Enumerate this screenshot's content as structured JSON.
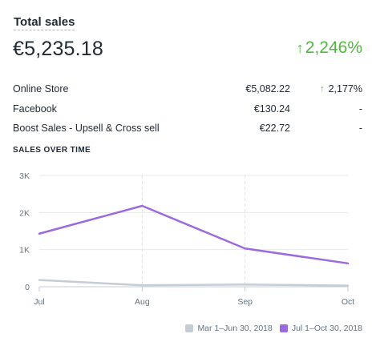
{
  "card": {
    "title": "Total sales",
    "total": "€5,235.18",
    "growth": "2,246%",
    "growth_color": "#50b83c",
    "rows": [
      {
        "name": "Online Store",
        "value": "€5,082.22",
        "change": "2,177%",
        "change_up": true
      },
      {
        "name": "Facebook",
        "value": "€130.24",
        "change": "-",
        "change_up": false
      },
      {
        "name": "Boost Sales - Upsell & Cross sell",
        "value": "€22.72",
        "change": "-",
        "change_up": false
      }
    ],
    "section_title": "SALES OVER TIME"
  },
  "chart_data": {
    "type": "line",
    "title": "",
    "xlabel": "",
    "ylabel": "",
    "categories": [
      "Jul",
      "Aug",
      "Sep",
      "Oct"
    ],
    "y_ticks": [
      0,
      1000,
      2000,
      3000
    ],
    "y_tick_labels": [
      "0",
      "1K",
      "2K",
      "3K"
    ],
    "ylim": [
      0,
      3000
    ],
    "grid": true,
    "legend_position": "bottom-right",
    "series": [
      {
        "name": "Mar 1–Jun 30, 2018",
        "color": "#c4cdd5",
        "values": [
          180,
          40,
          60,
          30
        ]
      },
      {
        "name": "Jul 1–Oct 30, 2018",
        "color": "#9c6ade",
        "values": [
          1430,
          2180,
          1030,
          630
        ]
      }
    ]
  }
}
